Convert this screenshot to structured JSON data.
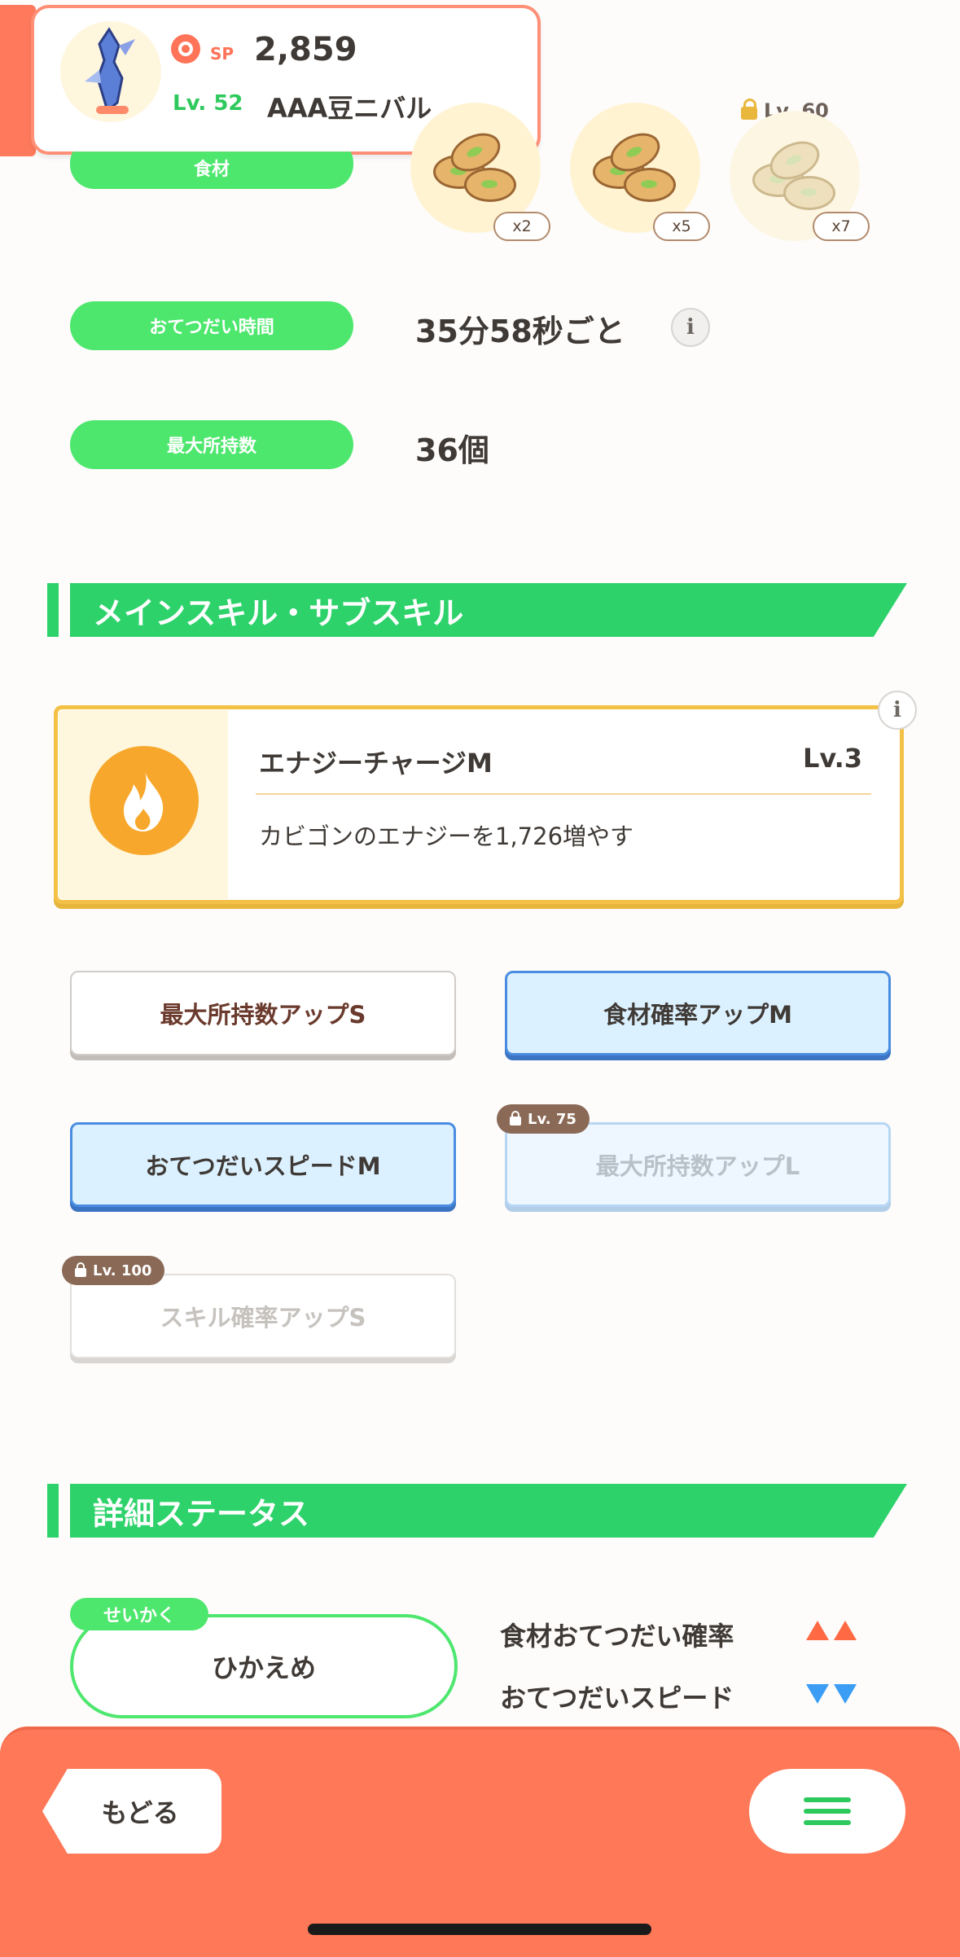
{
  "pokemon": {
    "sp_label": "SP",
    "sp_value": "2,859",
    "level": "Lv. 52",
    "name": "AAA豆ニバル"
  },
  "ingredients": {
    "label": "食材",
    "items": [
      {
        "qty": "x2",
        "locked": false
      },
      {
        "qty": "x5",
        "locked": false
      },
      {
        "qty": "x7",
        "locked": true,
        "unlock_level": "Lv. 60"
      }
    ]
  },
  "help_time": {
    "label": "おてつだい時間",
    "value": "35分58秒ごと",
    "info_icon": "info-icon"
  },
  "max_carry": {
    "label": "最大所持数",
    "value": "36個"
  },
  "skills_section": {
    "title": "メインスキル・サブスキル",
    "main_skill": {
      "name": "エナジーチャージM",
      "level": "Lv.3",
      "description": "カビゴンのエナジーを1,726増やす",
      "icon": "flame-icon",
      "icon_color": "#f7a72b"
    },
    "sub_skills": [
      {
        "label": "最大所持数アップS",
        "style": "white",
        "locked": false
      },
      {
        "label": "食材確率アップM",
        "style": "blue",
        "locked": false
      },
      {
        "label": "おてつだいスピードM",
        "style": "blue",
        "locked": false
      },
      {
        "label": "最大所持数アップL",
        "style": "blue",
        "locked": true,
        "unlock_level": "Lv. 75"
      },
      {
        "label": "スキル確率アップS",
        "style": "white",
        "locked": true,
        "unlock_level": "Lv. 100"
      }
    ]
  },
  "details_section": {
    "title": "詳細ステータス",
    "nature_tag": "せいかく",
    "nature": "ひかえめ",
    "stat_up": "食材おてつだい確率",
    "stat_down": "おてつだいスピード"
  },
  "footer": {
    "back_label": "もどる",
    "menu_icon": "hamburger-menu-icon"
  },
  "colors": {
    "accent_green": "#2ed26b",
    "footer": "#ff7858",
    "up_arrow": "#ff6a44",
    "down_arrow": "#3c9df4"
  }
}
